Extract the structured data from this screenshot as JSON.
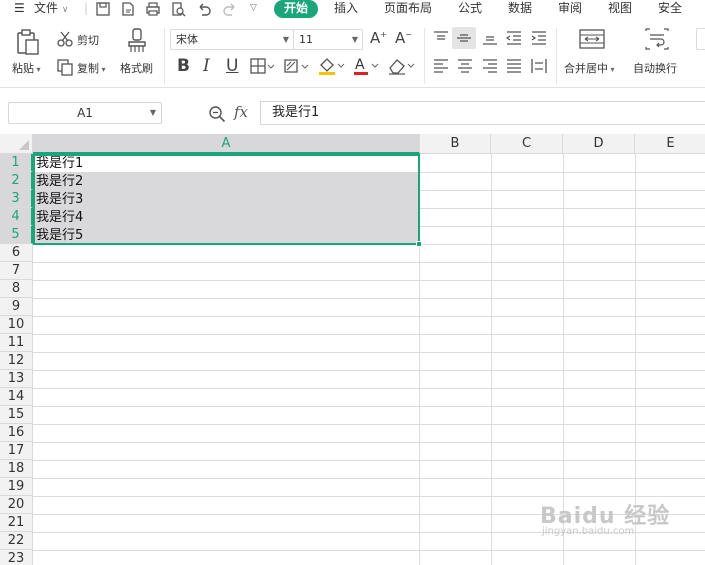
{
  "menu": {
    "file_label": "文件",
    "tabs": [
      "开始",
      "插入",
      "页面布局",
      "公式",
      "数据",
      "审阅",
      "视图",
      "安全"
    ],
    "active_tab": "开始"
  },
  "ribbon": {
    "paste_label": "粘贴",
    "cut_label": "剪切",
    "copy_label": "复制",
    "format_painter_label": "格式刷",
    "font_name": "宋体",
    "font_size": "11",
    "merge_label": "合并居中",
    "wrap_label": "自动换行",
    "bold_glyph": "B",
    "italic_glyph": "I",
    "underline_glyph": "U"
  },
  "formula_bar": {
    "name_box": "A1",
    "fx_label": "fx",
    "content": "我是行1"
  },
  "grid": {
    "columns": [
      "A",
      "B",
      "C",
      "D",
      "E"
    ],
    "rows": [
      "1",
      "2",
      "3",
      "4",
      "5",
      "6",
      "7",
      "8",
      "9",
      "10",
      "11",
      "12",
      "13",
      "14",
      "15",
      "16",
      "17",
      "18",
      "19",
      "20",
      "21",
      "22",
      "23"
    ],
    "cells": [
      "我是行1",
      "我是行2",
      "我是行3",
      "我是行4",
      "我是行5"
    ]
  },
  "watermark": {
    "brand": "Baidu 经验",
    "url": "jingyan.baidu.com"
  },
  "colors": {
    "accent": "#1aa67a",
    "selection_fill": "#d9d9db",
    "header_fill": "#f2f2f2"
  }
}
